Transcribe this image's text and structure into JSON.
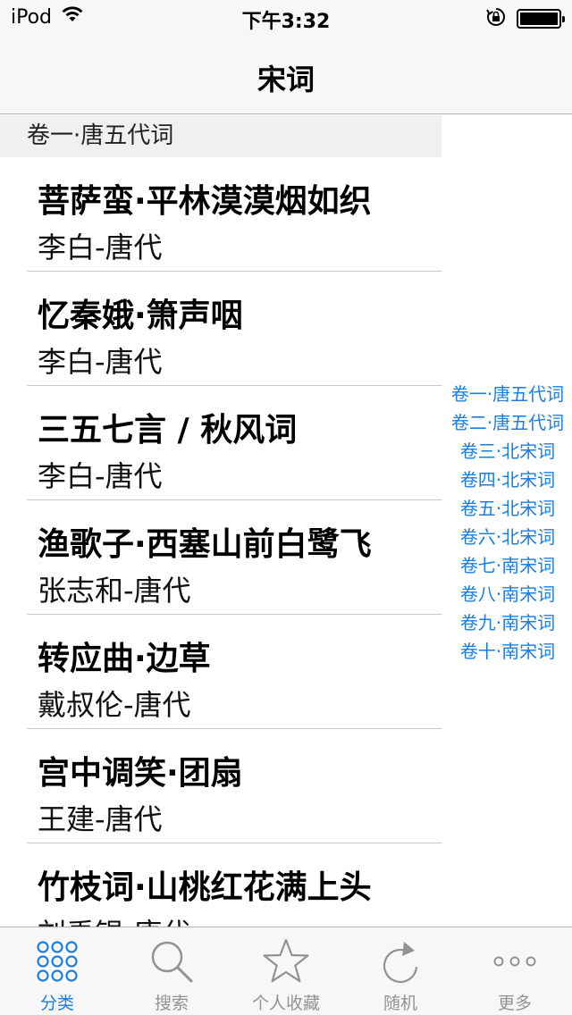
{
  "status": {
    "carrier": "iPod",
    "time": "下午3:32",
    "battery_level": 1.0
  },
  "nav": {
    "title": "宋词"
  },
  "section": {
    "header": "卷一·唐五代词"
  },
  "rows": [
    {
      "title": "菩萨蛮·平林漠漠烟如织",
      "author": "李白-唐代"
    },
    {
      "title": "忆秦娥·箫声咽",
      "author": "李白-唐代"
    },
    {
      "title": "三五七言 / 秋风词",
      "author": "李白-唐代"
    },
    {
      "title": "渔歌子·西塞山前白鹭飞",
      "author": "张志和-唐代"
    },
    {
      "title": "转应曲·边草",
      "author": "戴叔伦-唐代"
    },
    {
      "title": "宫中调笑·团扇",
      "author": "王建-唐代"
    },
    {
      "title": "竹枝词·山桃红花满上头",
      "author": "刘禹锡-唐代"
    }
  ],
  "index": [
    "卷一·唐五代词",
    "卷二·唐五代词",
    "卷三·北宋词",
    "卷四·北宋词",
    "卷五·北宋词",
    "卷六·北宋词",
    "卷七·南宋词",
    "卷八·南宋词",
    "卷九·南宋词",
    "卷十·南宋词"
  ],
  "tabs": [
    {
      "label": "分类",
      "icon": "grid-dots-icon",
      "selected": true
    },
    {
      "label": "搜索",
      "icon": "search-icon",
      "selected": false
    },
    {
      "label": "个人收藏",
      "icon": "star-icon",
      "selected": false
    },
    {
      "label": "随机",
      "icon": "refresh-icon",
      "selected": false
    },
    {
      "label": "更多",
      "icon": "more-icon",
      "selected": false
    }
  ],
  "colors": {
    "accent": "#1a7fe0",
    "inactive": "#929292",
    "bar_background": "#f7f7f7",
    "section_background": "#f0f0f0"
  }
}
